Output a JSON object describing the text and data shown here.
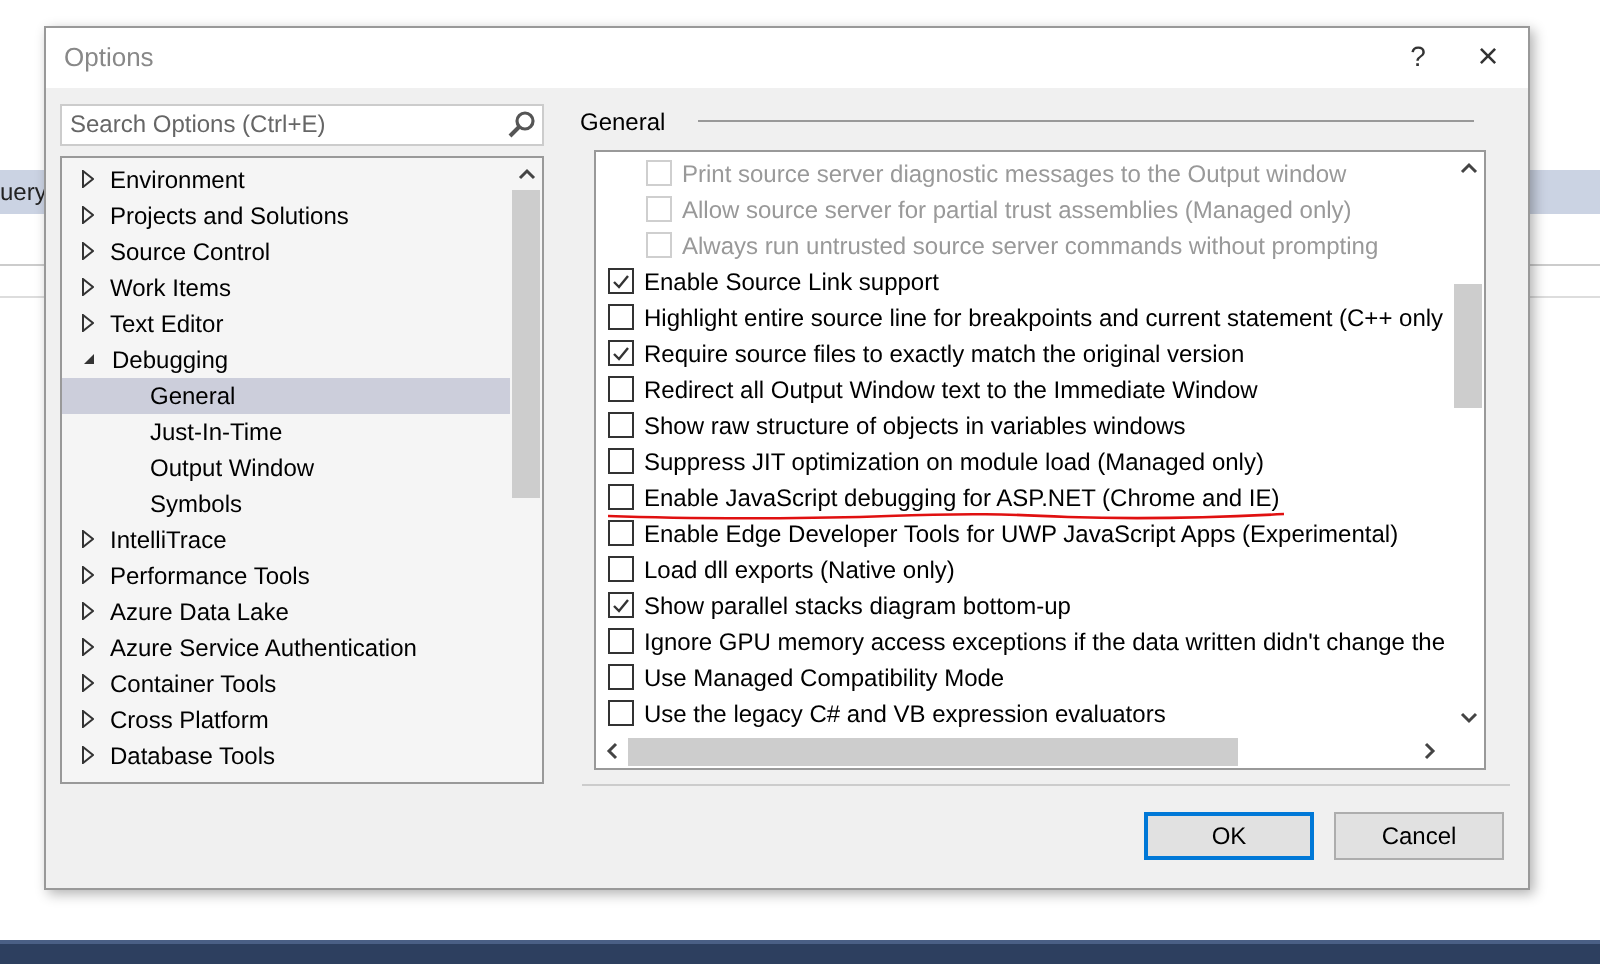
{
  "background": {
    "tab_label": "uery"
  },
  "window": {
    "title": "Options",
    "help": "?",
    "close": "×"
  },
  "search": {
    "placeholder": "Search Options (Ctrl+E)"
  },
  "tree": [
    {
      "label": "Environment",
      "expanded": false
    },
    {
      "label": "Projects and Solutions",
      "expanded": false
    },
    {
      "label": "Source Control",
      "expanded": false
    },
    {
      "label": "Work Items",
      "expanded": false
    },
    {
      "label": "Text Editor",
      "expanded": false
    },
    {
      "label": "Debugging",
      "expanded": true,
      "children": [
        {
          "label": "General",
          "selected": true
        },
        {
          "label": "Just-In-Time",
          "selected": false
        },
        {
          "label": "Output Window",
          "selected": false
        },
        {
          "label": "Symbols",
          "selected": false
        }
      ]
    },
    {
      "label": "IntelliTrace",
      "expanded": false
    },
    {
      "label": "Performance Tools",
      "expanded": false
    },
    {
      "label": "Azure Data Lake",
      "expanded": false
    },
    {
      "label": "Azure Service Authentication",
      "expanded": false
    },
    {
      "label": "Container Tools",
      "expanded": false
    },
    {
      "label": "Cross Platform",
      "expanded": false
    },
    {
      "label": "Database Tools",
      "expanded": false
    }
  ],
  "page": {
    "heading": "General"
  },
  "options": [
    {
      "kind": "suboption",
      "label": "Print source server diagnostic messages to the Output window",
      "checked": false,
      "disabled": true
    },
    {
      "kind": "suboption",
      "label": "Allow source server for partial trust assemblies (Managed only)",
      "checked": false,
      "disabled": true
    },
    {
      "kind": "suboption",
      "label": "Always run untrusted source server commands without prompting",
      "checked": false,
      "disabled": true
    },
    {
      "kind": "option",
      "label": "Enable Source Link support",
      "checked": true,
      "disabled": false
    },
    {
      "kind": "option",
      "label": "Highlight entire source line for breakpoints and current statement (C++ only",
      "checked": false,
      "disabled": false
    },
    {
      "kind": "option",
      "label": "Require source files to exactly match the original version",
      "checked": true,
      "disabled": false
    },
    {
      "kind": "option",
      "label": "Redirect all Output Window text to the Immediate Window",
      "checked": false,
      "disabled": false
    },
    {
      "kind": "option",
      "label": "Show raw structure of objects in variables windows",
      "checked": false,
      "disabled": false
    },
    {
      "kind": "option",
      "label": "Suppress JIT optimization on module load (Managed only)",
      "checked": false,
      "disabled": false
    },
    {
      "kind": "option",
      "label": "Enable JavaScript debugging for ASP.NET (Chrome and IE)",
      "checked": false,
      "disabled": false
    },
    {
      "kind": "option",
      "label": "Enable Edge Developer Tools for UWP JavaScript Apps (Experimental)",
      "checked": false,
      "disabled": false
    },
    {
      "kind": "option",
      "label": "Load dll exports (Native only)",
      "checked": false,
      "disabled": false
    },
    {
      "kind": "option",
      "label": "Show parallel stacks diagram bottom-up",
      "checked": true,
      "disabled": false
    },
    {
      "kind": "option",
      "label": "Ignore GPU memory access exceptions if the data written didn't change the",
      "checked": false,
      "disabled": false
    },
    {
      "kind": "option",
      "label": "Use Managed Compatibility Mode",
      "checked": false,
      "disabled": false
    },
    {
      "kind": "option",
      "label": "Use the legacy C# and VB expression evaluators",
      "checked": false,
      "disabled": false
    }
  ],
  "buttons": [
    {
      "label": "OK",
      "default": true
    },
    {
      "label": "Cancel",
      "default": false
    }
  ]
}
